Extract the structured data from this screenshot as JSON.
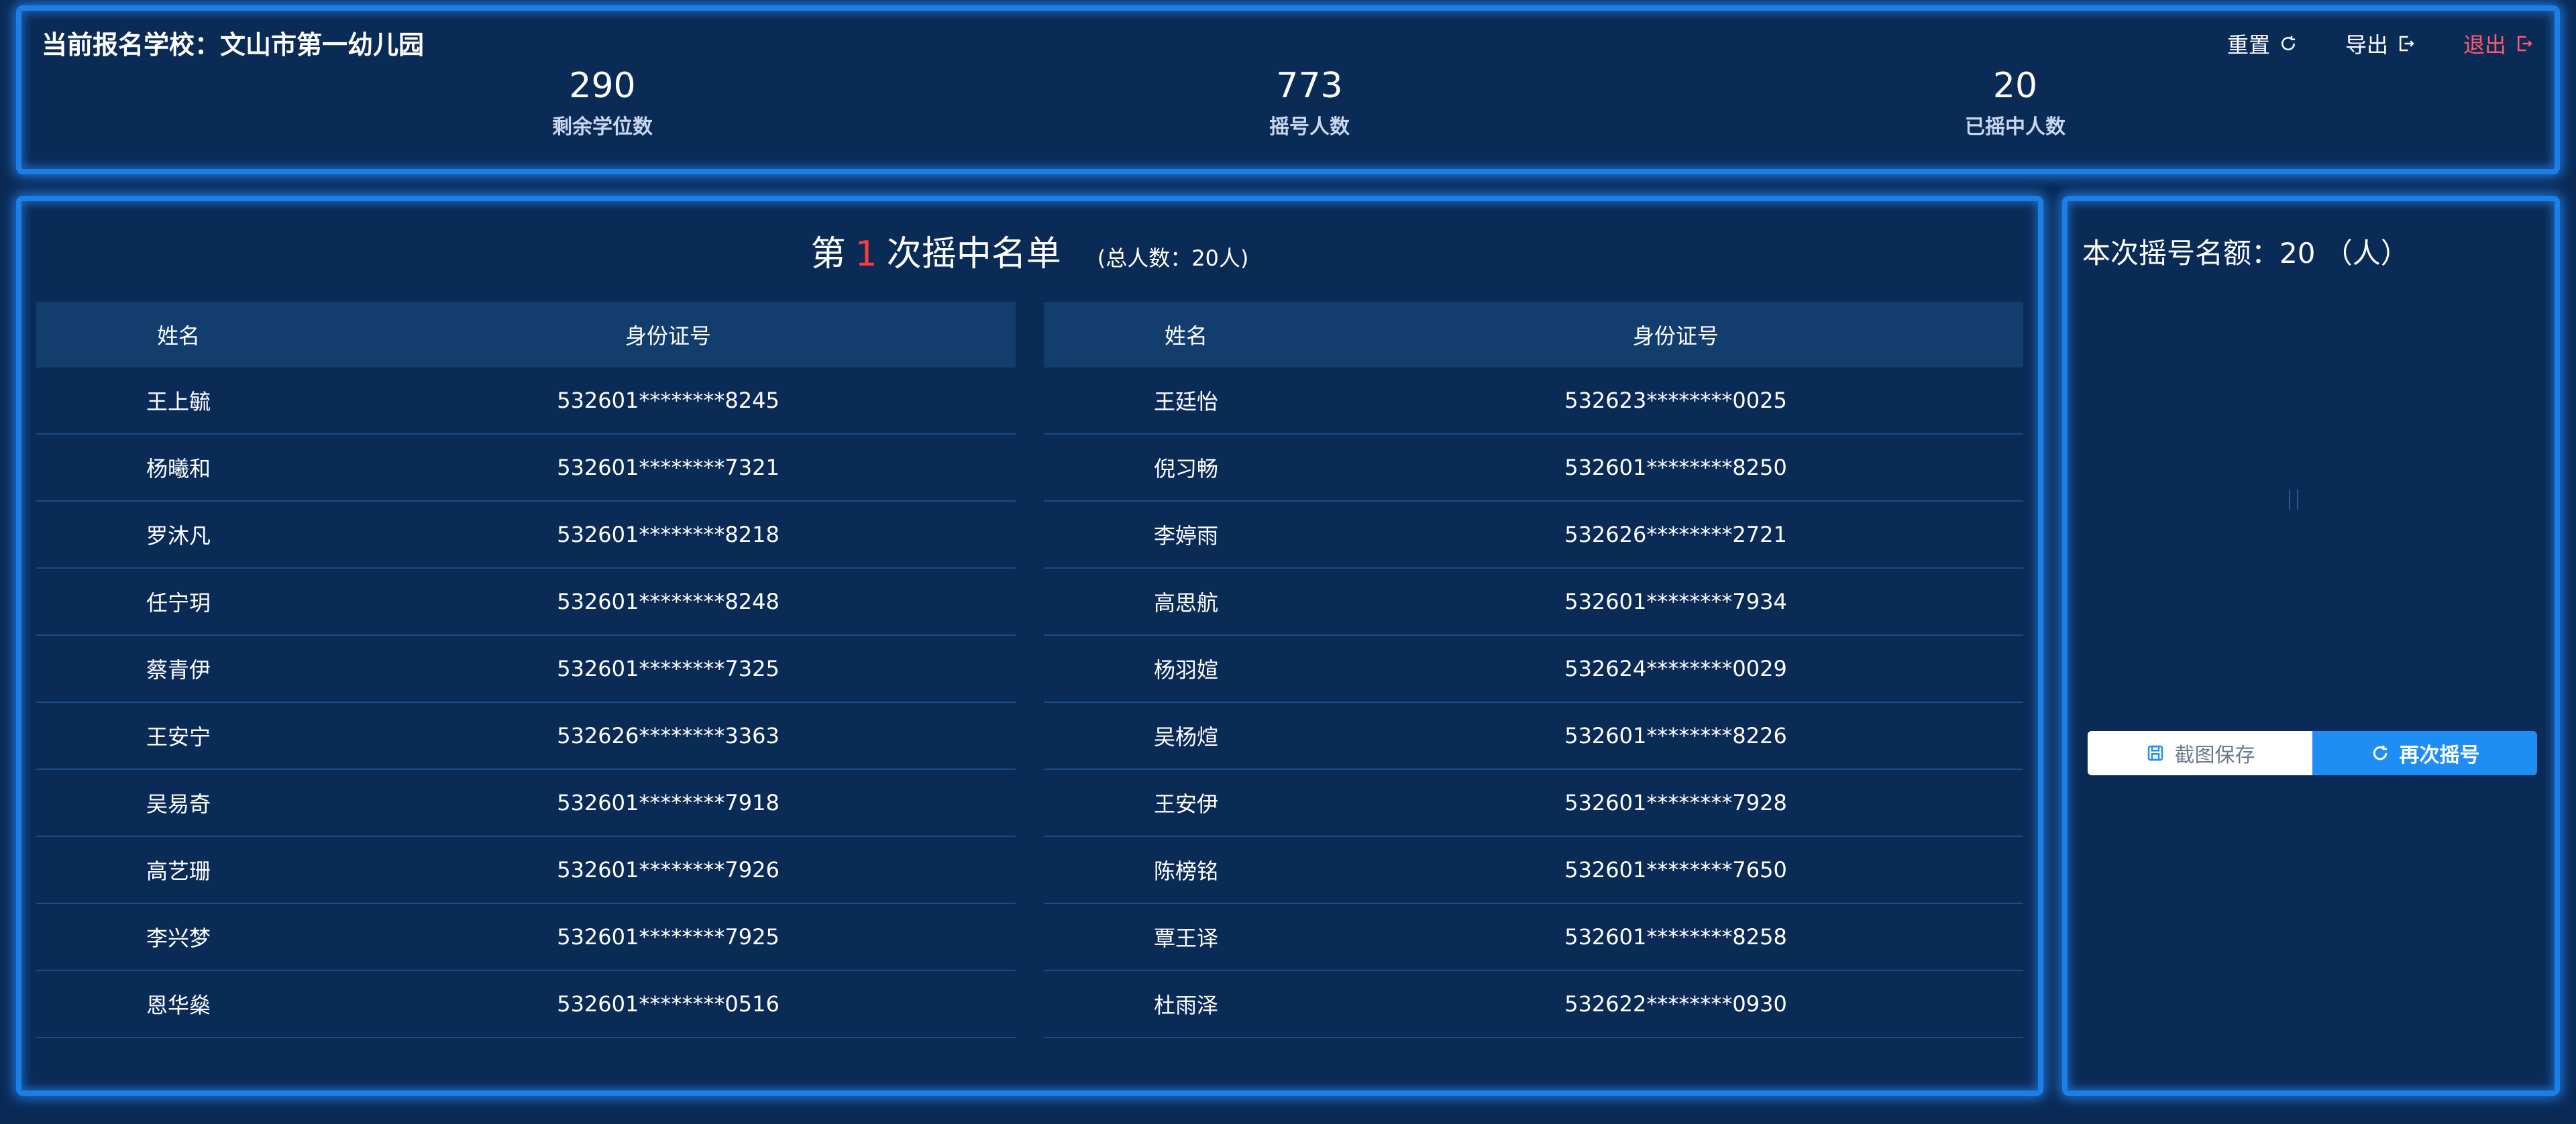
{
  "header": {
    "school_label": "当前报名学校：文山市第一幼儿园",
    "actions": {
      "reset": "重置",
      "export": "导出",
      "exit": "退出"
    },
    "stats": [
      {
        "value": "290",
        "label": "剩余学位数"
      },
      {
        "value": "773",
        "label": "摇号人数"
      },
      {
        "value": "20",
        "label": "已摇中人数"
      }
    ]
  },
  "list": {
    "title_prefix": "第",
    "round": "1",
    "title_suffix": "次摇中名单",
    "total": "(总人数：20人)",
    "columns": {
      "name": "姓名",
      "id": "身份证号"
    },
    "left": [
      {
        "name": "王上毓",
        "id": "532601********8245"
      },
      {
        "name": "杨曦和",
        "id": "532601********7321"
      },
      {
        "name": "罗沐凡",
        "id": "532601********8218"
      },
      {
        "name": "任宁玥",
        "id": "532601********8248"
      },
      {
        "name": "蔡青伊",
        "id": "532601********7325"
      },
      {
        "name": "王安宁",
        "id": "532626********3363"
      },
      {
        "name": "吴易奇",
        "id": "532601********7918"
      },
      {
        "name": "高艺珊",
        "id": "532601********7926"
      },
      {
        "name": "李兴梦",
        "id": "532601********7925"
      },
      {
        "name": "恩华燊",
        "id": "532601********0516"
      }
    ],
    "right": [
      {
        "name": "王廷怡",
        "id": "532623********0025"
      },
      {
        "name": "倪习畅",
        "id": "532601********8250"
      },
      {
        "name": "李婷雨",
        "id": "532626********2721"
      },
      {
        "name": "高思航",
        "id": "532601********7934"
      },
      {
        "name": "杨羽媗",
        "id": "532624********0029"
      },
      {
        "name": "吴杨煊",
        "id": "532601********8226"
      },
      {
        "name": "王安伊",
        "id": "532601********7928"
      },
      {
        "name": "陈榜铭",
        "id": "532601********7650"
      },
      {
        "name": "覃王译",
        "id": "532601********8258"
      },
      {
        "name": "杜雨泽",
        "id": "532622********0930"
      }
    ]
  },
  "side": {
    "quota": "本次摇号名额：20 （人）",
    "save_label": "截图保存",
    "again_label": "再次摇号"
  },
  "colors": {
    "background": "#0a2a55",
    "frame_glow": "#1b7fe8",
    "header_row": "#123d6d",
    "accent_red": "#ff3b3b",
    "exit_red": "#ff5a6a",
    "primary_button": "#1e8ef5"
  },
  "icons": {
    "reset": "reload-icon",
    "export": "export-icon",
    "exit": "logout-icon",
    "save": "save-icon",
    "again": "reload-icon"
  }
}
